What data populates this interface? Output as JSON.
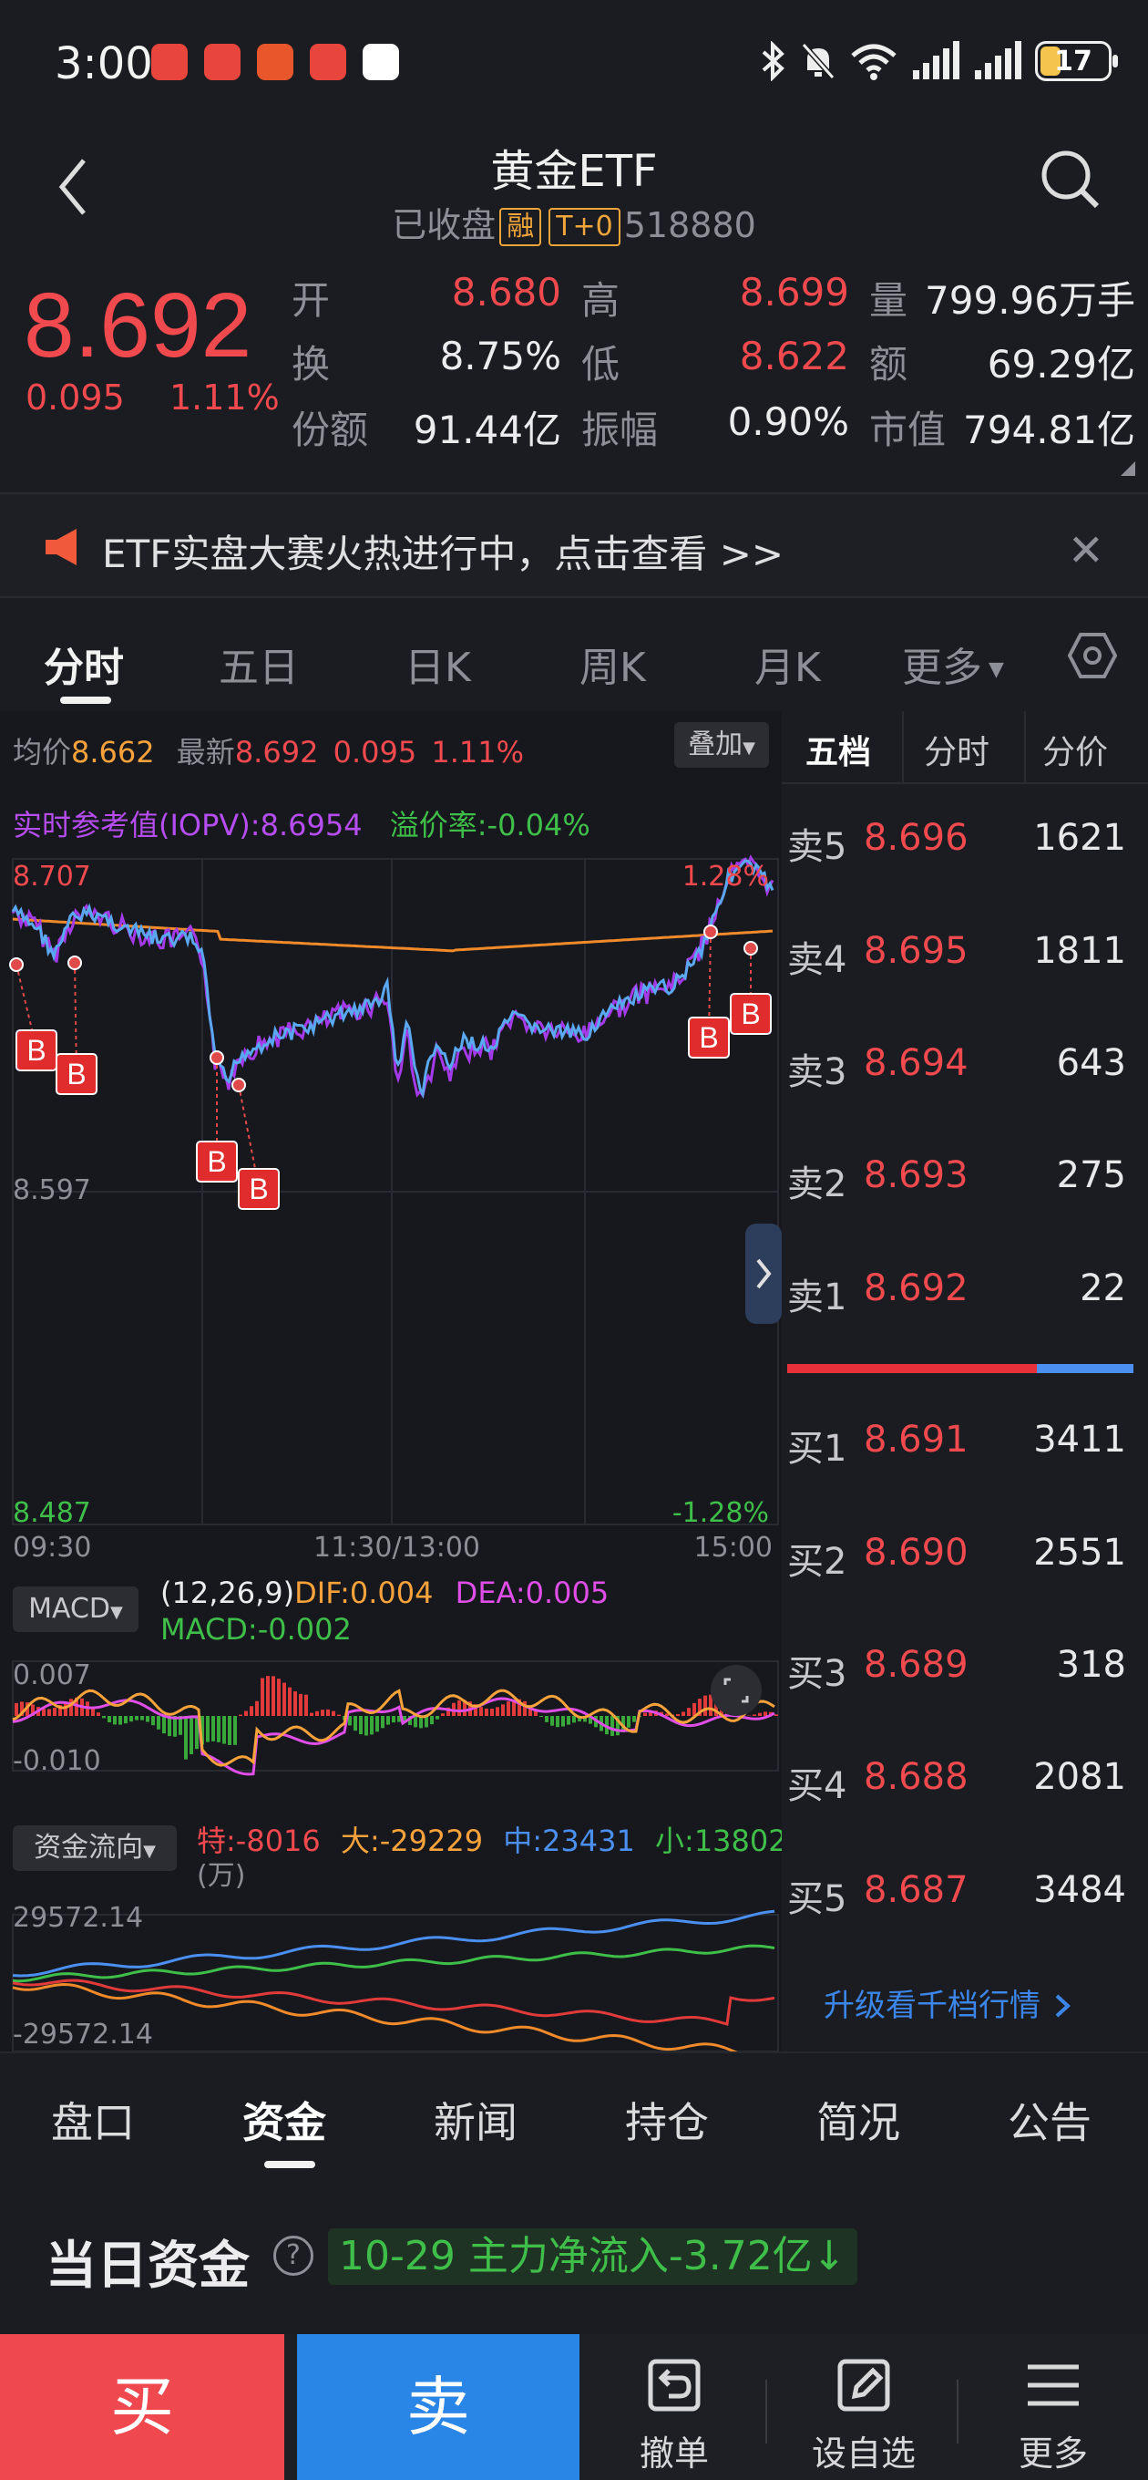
{
  "status": {
    "time": "3:00",
    "battery": "17",
    "app_icon_colors": [
      "#e8453c",
      "#e8453c",
      "#e8453c",
      "#e8453c",
      "#ffffff"
    ]
  },
  "header": {
    "title": "黄金ETF",
    "status": "已收盘",
    "tag_margin": "融",
    "tag_t0": "T+0",
    "code": "518880"
  },
  "quote": {
    "price": "8.692",
    "change": "0.095",
    "change_pct": "1.11%",
    "open_label": "开",
    "open": "8.680",
    "high_label": "高",
    "high": "8.699",
    "volume_label": "量",
    "volume": "799.96万手",
    "turnover_label": "换",
    "turnover": "8.75%",
    "low_label": "低",
    "low": "8.622",
    "amount_label": "额",
    "amount": "69.29亿",
    "shares_label": "份额",
    "shares": "91.44亿",
    "amplitude_label": "振幅",
    "amplitude": "0.90%",
    "mcap_label": "市值",
    "mcap": "794.81亿"
  },
  "banner": {
    "text": "ETF实盘大赛火热进行中，点击查看 >>",
    "close": "✕"
  },
  "chart_tabs": [
    "分时",
    "五日",
    "日K",
    "周K",
    "月K",
    "更多"
  ],
  "info_bar": {
    "avg_label": "均价",
    "avg": "8.662",
    "last_label": "最新",
    "last": "8.692",
    "chg": "0.095",
    "pct": "1.11%",
    "overlay": "叠加"
  },
  "iopv": {
    "label": "实时参考值(IOPV):",
    "value": "8.6954",
    "premium_label": "溢价率:",
    "premium": "-0.04%"
  },
  "axis": {
    "top": "8.707",
    "mid": "8.597",
    "bottom": "8.487",
    "top_pct": "1.28%",
    "bottom_pct": "-1.28%",
    "t_start": "09:30",
    "t_mid": "11:30/13:00",
    "t_end": "15:00"
  },
  "macd": {
    "select": "MACD",
    "params": "(12,26,9)",
    "dif_label": "DIF:",
    "dif": "0.004",
    "dea_label": "DEA:",
    "dea": "0.005",
    "macd_label": "MACD:",
    "macd": "-0.002",
    "top": "0.007",
    "bottom": "-0.010"
  },
  "flow": {
    "select": "资金流向",
    "te": "特:-8016",
    "da": "大:-29229",
    "zhong": "中:23431",
    "xiao": "小:13802",
    "unit": "(万)",
    "top": "29572.14",
    "bottom": "-29572.14"
  },
  "orderbook": {
    "tabs": [
      "五档",
      "分时",
      "分价"
    ],
    "asks": [
      {
        "label": "卖5",
        "price": "8.696",
        "vol": "1621"
      },
      {
        "label": "卖4",
        "price": "8.695",
        "vol": "1811"
      },
      {
        "label": "卖3",
        "price": "8.694",
        "vol": "643"
      },
      {
        "label": "卖2",
        "price": "8.693",
        "vol": "275"
      },
      {
        "label": "卖1",
        "price": "8.692",
        "vol": "22"
      }
    ],
    "bids": [
      {
        "label": "买1",
        "price": "8.691",
        "vol": "3411"
      },
      {
        "label": "买2",
        "price": "8.690",
        "vol": "2551"
      },
      {
        "label": "买3",
        "price": "8.689",
        "vol": "318"
      },
      {
        "label": "买4",
        "price": "8.688",
        "vol": "2081"
      },
      {
        "label": "买5",
        "price": "8.687",
        "vol": "3484"
      }
    ],
    "upgrade": "升级看千档行情",
    "buy_ratio": 0.72
  },
  "bottom_tabs": [
    "盘口",
    "资金",
    "新闻",
    "持仓",
    "简况",
    "公告"
  ],
  "fund": {
    "title": "当日资金",
    "help": "?",
    "summary": "10-29 主力净流入-3.72亿↓"
  },
  "actions": {
    "buy": "买",
    "sell": "卖",
    "cancel": "撤单",
    "watch": "设自选",
    "more": "更多"
  },
  "buy_marker": "B"
}
